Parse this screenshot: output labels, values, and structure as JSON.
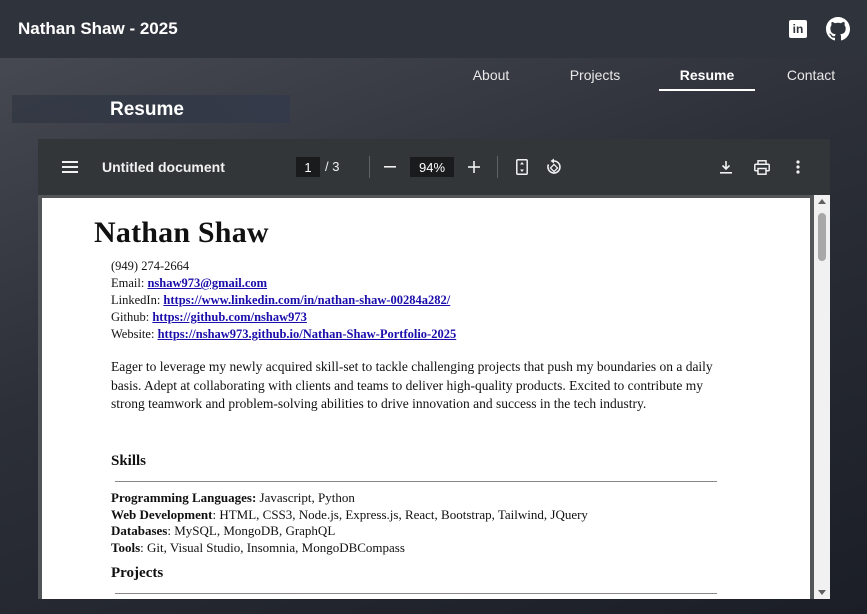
{
  "header": {
    "brand": "Nathan Shaw - 2025"
  },
  "social": {
    "linkedin_glyph": "in"
  },
  "nav": {
    "items": [
      "About",
      "Projects",
      "Resume",
      "Contact"
    ],
    "active": "Resume"
  },
  "section": {
    "title": "Resume"
  },
  "viewer": {
    "doc_title": "Untitled document",
    "current_page": "1",
    "total_pages": "/  3",
    "zoom": "94%"
  },
  "resume": {
    "name": "Nathan Shaw",
    "phone": "(949) 274-2664",
    "email_label": "Email: ",
    "email": "nshaw973@gmail.com",
    "linkedin_label": "LinkedIn: ",
    "linkedin": "https://www.linkedin.com/in/nathan-shaw-00284a282/",
    "github_label": "Github: ",
    "github": "https://github.com/nshaw973",
    "website_label": "Website: ",
    "website": "https://nshaw973.github.io/Nathan-Shaw-Portfolio-2025",
    "summary": "Eager to leverage my newly acquired skill-set to tackle challenging projects that push my boundaries on a daily basis. Adept at collaborating with clients and teams to deliver high-quality products. Excited to contribute my strong teamwork and problem-solving abilities to drive innovation and success in the tech industry.",
    "skills_heading": "Skills",
    "skills": [
      {
        "label": "Programming Languages:",
        "value": " Javascript, Python"
      },
      {
        "label": "Web Development",
        "value": ": HTML, CSS3, Node.js, Express.js, React, Bootstrap, Tailwind, JQuery"
      },
      {
        "label": "Databases",
        "value": ": MySQL, MongoDB, GraphQL"
      },
      {
        "label": "Tools",
        "value": ": Git, Visual Studio, Insomnia, MongoDBCompass"
      }
    ],
    "projects_heading": "Projects"
  },
  "colors": {
    "topbar": "#2f333b",
    "toolbar": "#323639",
    "link": "#1a0dab"
  }
}
